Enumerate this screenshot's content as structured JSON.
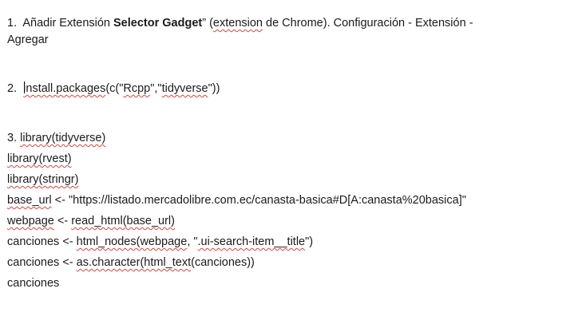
{
  "step1": {
    "number": "1.",
    "text_a": "Añadir Extensión ",
    "bold": "Selector Gadget",
    "text_b": "” (",
    "extension_word": "extension",
    "text_c": " de Chrome). Configuración - Extensión -",
    "wrap": "Agregar"
  },
  "step2": {
    "number": "2.",
    "fn": "install.packages",
    "args_open": "(c(\"",
    "pkg1": "Rcpp",
    "sep": "\",\"",
    "pkg2": "tidyverse",
    "args_close": "\"))"
  },
  "step3": {
    "number": "3.",
    "l1_fn": "library(tidyverse)",
    "l2_fn": "library(rvest)",
    "l3_fn": "library(stringr)",
    "l4_var": "base_url",
    "l4_rest": " <- \"https://listado.mercadolibre.com.ec/canasta-basica#D[A:canasta%20basica]\"",
    "l5_var": "webpage",
    "l5_mid": " <- ",
    "l5_call": "read_html(base_url)",
    "l6_a": "canciones <- ",
    "l6_fn": "html_nodes(webpage",
    "l6_b": ", \"",
    "l6_sel": ".ui-search-item__title",
    "l6_c": "\")",
    "l7_a": "canciones <- ",
    "l7_fn": "as.character(html_text",
    "l7_c": "(canciones))",
    "l8": "canciones"
  }
}
